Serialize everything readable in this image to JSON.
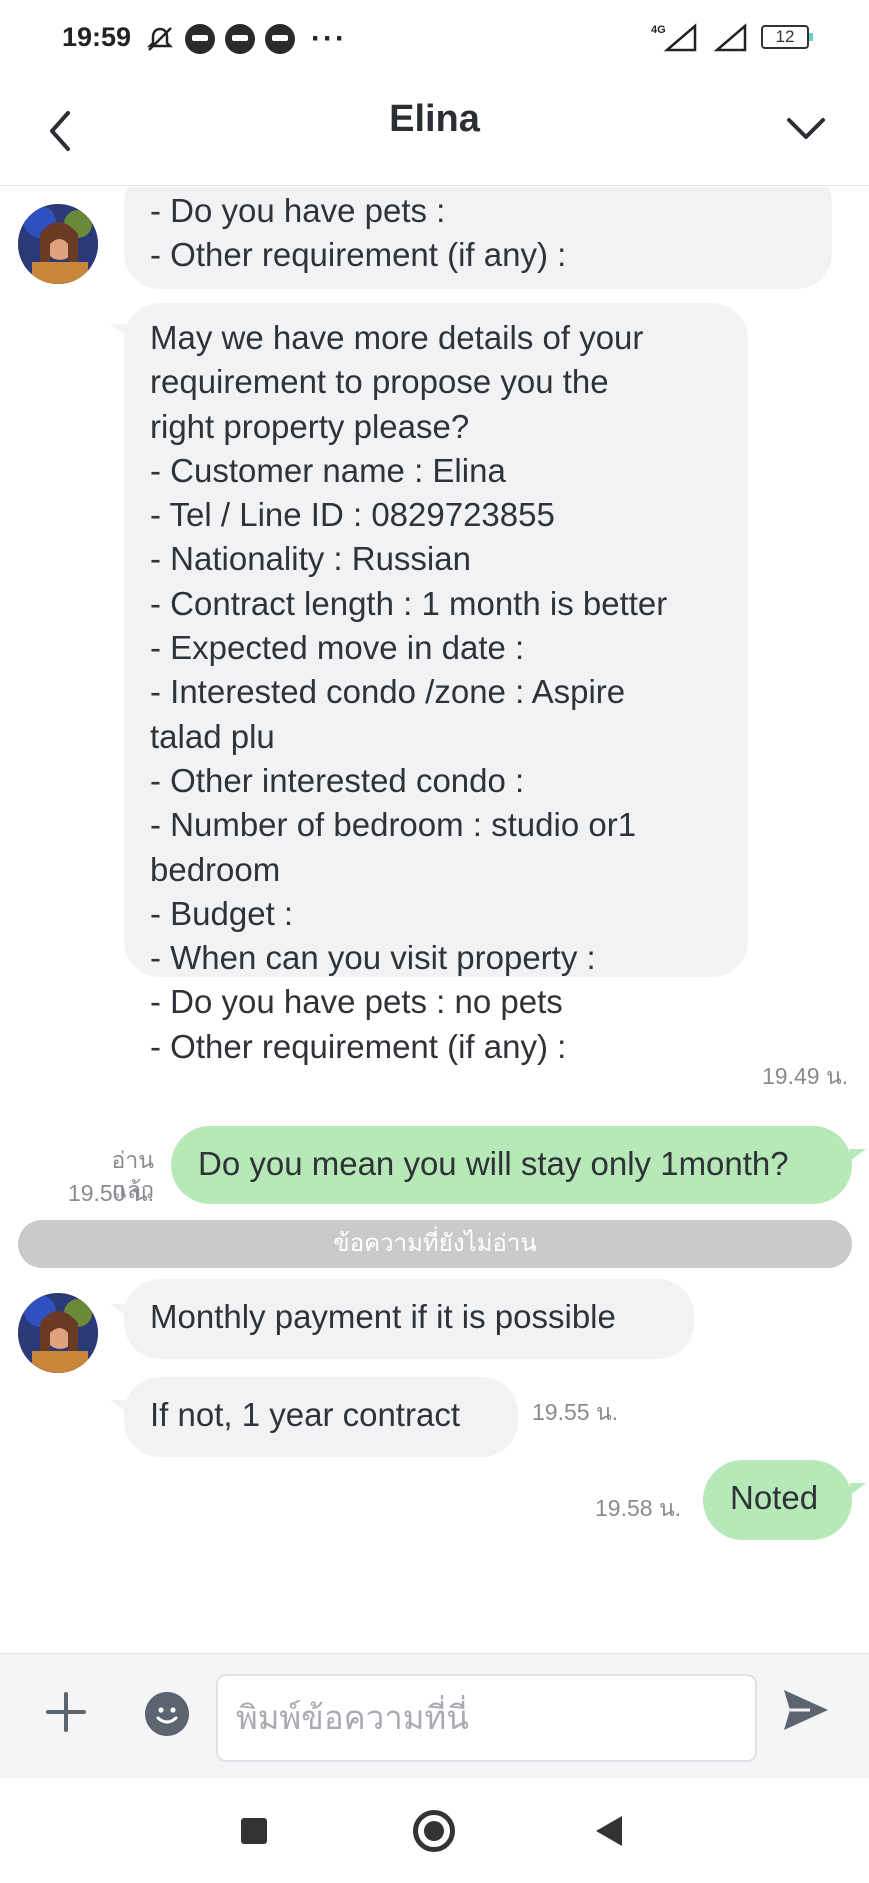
{
  "status_bar": {
    "time": "19:59",
    "network": "4G",
    "battery": "12",
    "more": "···"
  },
  "header": {
    "title": "Elina"
  },
  "messages": {
    "m1": {
      "text": "- Do you have pets :\n- Other requirement (if any) :"
    },
    "m2": {
      "text": "May we have more details of your\nrequirement to propose you the\nright property please?\n- Customer name : Elina\n- Tel / Line ID : 0829723855\n- Nationality : Russian\n- Contract length : 1 month is better\n- Expected move in date :\n- Interested condo /zone : Aspire\ntalad plu\n- Other interested condo :\n- Number of bedroom  : studio or1\nbedroom\n- Budget :\n- When can you visit property :\n- Do you have pets : no pets\n- Other requirement (if any) :",
      "time": "19.49 น."
    },
    "m3": {
      "text": "Do you mean you will stay only 1month?",
      "read": "อ่านแล้ว",
      "time": "19.50 น."
    },
    "unread_divider": "ข้อความที่ยังไม่อ่าน",
    "m4": {
      "text": "Monthly payment if it is possible"
    },
    "m5": {
      "text": "If not, 1 year contract",
      "time": "19.55 น."
    },
    "m6": {
      "text": "Noted",
      "time": "19.58 น."
    }
  },
  "input": {
    "placeholder": "พิมพ์ข้อความที่นี่"
  },
  "colors": {
    "incoming_bubble": "#f1f2f4",
    "outgoing_bubble": "#b7e8b7",
    "divider": "#c9cacc"
  },
  "icons": {
    "back": "chevron-left-icon",
    "menu": "chevron-down-icon",
    "add": "plus-icon",
    "emoji": "emoji-icon",
    "send": "send-icon"
  }
}
